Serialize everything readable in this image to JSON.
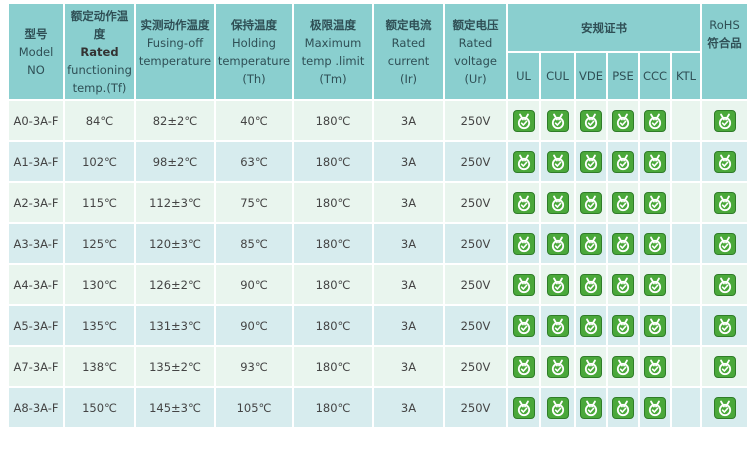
{
  "headers": {
    "model": {
      "zh": "型号",
      "en1": "Model",
      "en2": "NO"
    },
    "rated": {
      "zh": "额定动作温度",
      "en_bold": "Rated",
      "en1": "functioning",
      "en2": "temp.(Tf)"
    },
    "fusing": {
      "zh": "实测动作温度",
      "en1": "Fusing-off",
      "en2": "temperature"
    },
    "holding": {
      "zh": "保持温度",
      "en1": "Holding",
      "en2": "temperature",
      "en3": "(Th)"
    },
    "max": {
      "zh": "极限温度",
      "en1": "Maximum",
      "en2": "temp .limit",
      "en3": "(Tm)"
    },
    "current": {
      "zh": "额定电流",
      "en1": "Rated",
      "en2": "current",
      "en3": "(Ir)"
    },
    "voltage": {
      "zh": "额定电压",
      "en1": "Rated",
      "en2": "voltage",
      "en3": "(Ur)"
    },
    "certs": {
      "zh": "安规证书",
      "cols": [
        "UL",
        "CUL",
        "VDE",
        "PSE",
        "CCC",
        "KTL"
      ]
    },
    "rohs": {
      "en": "RoHS",
      "zh": "符合品"
    }
  },
  "rows": [
    {
      "model": "A0-3A-F",
      "tf": "84℃",
      "fusing": "82±2℃",
      "th": "40℃",
      "tm": "180℃",
      "ir": "3A",
      "ur": "250V",
      "certs": [
        true,
        true,
        true,
        true,
        true,
        false
      ],
      "rohs": true
    },
    {
      "model": "A1-3A-F",
      "tf": "102℃",
      "fusing": "98±2℃",
      "th": "63℃",
      "tm": "180℃",
      "ir": "3A",
      "ur": "250V",
      "certs": [
        true,
        true,
        true,
        true,
        true,
        false
      ],
      "rohs": true
    },
    {
      "model": "A2-3A-F",
      "tf": "115℃",
      "fusing": "112±3℃",
      "th": "75℃",
      "tm": "180℃",
      "ir": "3A",
      "ur": "250V",
      "certs": [
        true,
        true,
        true,
        true,
        true,
        false
      ],
      "rohs": true
    },
    {
      "model": "A3-3A-F",
      "tf": "125℃",
      "fusing": "120±3℃",
      "th": "85℃",
      "tm": "180℃",
      "ir": "3A",
      "ur": "250V",
      "certs": [
        true,
        true,
        true,
        true,
        true,
        false
      ],
      "rohs": true
    },
    {
      "model": "A4-3A-F",
      "tf": "130℃",
      "fusing": "126±2℃",
      "th": "90℃",
      "tm": "180℃",
      "ir": "3A",
      "ur": "250V",
      "certs": [
        true,
        true,
        true,
        true,
        true,
        false
      ],
      "rohs": true
    },
    {
      "model": "A5-3A-F",
      "tf": "135℃",
      "fusing": "131±3℃",
      "th": "90℃",
      "tm": "180℃",
      "ir": "3A",
      "ur": "250V",
      "certs": [
        true,
        true,
        true,
        true,
        true,
        false
      ],
      "rohs": true
    },
    {
      "model": "A7-3A-F",
      "tf": "138℃",
      "fusing": "135±2℃",
      "th": "93℃",
      "tm": "180℃",
      "ir": "3A",
      "ur": "250V",
      "certs": [
        true,
        true,
        true,
        true,
        true,
        false
      ],
      "rohs": true
    },
    {
      "model": "A8-3A-F",
      "tf": "150℃",
      "fusing": "145±3℃",
      "th": "105℃",
      "tm": "180℃",
      "ir": "3A",
      "ur": "250V",
      "certs": [
        true,
        true,
        true,
        true,
        true,
        false
      ],
      "rohs": true
    }
  ],
  "icon": "certified-check-icon",
  "colors": {
    "header": "#8acfcf",
    "row_odd": "#e9f5ee",
    "row_even": "#d7ecee",
    "badge": "#4aa83a"
  }
}
